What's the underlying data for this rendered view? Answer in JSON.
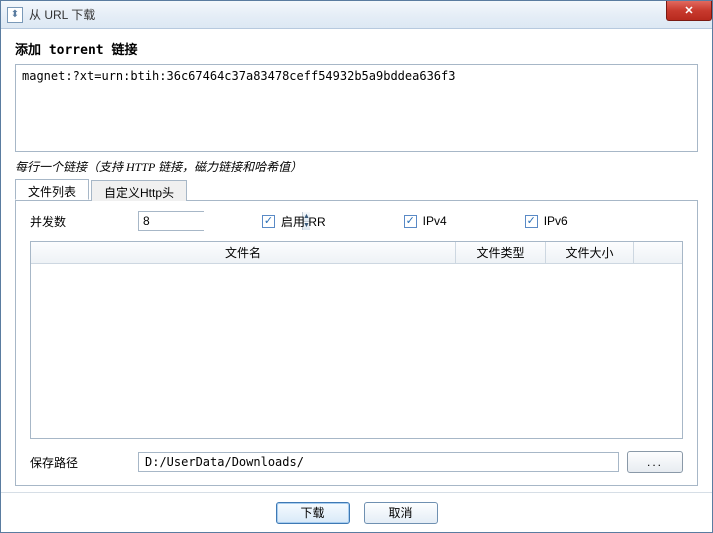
{
  "window": {
    "title": "从 URL 下载"
  },
  "section": {
    "heading": "添加 torrent 链接"
  },
  "url_input": {
    "value": "magnet:?xt=urn:btih:36c67464c37a83478ceff54932b5a9bddea636f3"
  },
  "hint": "每行一个链接（支持 HTTP 链接，磁力链接和哈希值）",
  "tabs": {
    "file_list": "文件列表",
    "http_headers": "自定义Http头"
  },
  "options": {
    "concurrency_label": "并发数",
    "concurrency_value": "8",
    "enable_rr_label": "启用 RR",
    "enable_rr_checked": true,
    "ipv4_label": "IPv4",
    "ipv4_checked": true,
    "ipv6_label": "IPv6",
    "ipv6_checked": true
  },
  "table": {
    "columns": {
      "name": "文件名",
      "type": "文件类型",
      "size": "文件大小"
    },
    "rows": []
  },
  "save": {
    "label": "保存路径",
    "value": "D:/UserData/Downloads/",
    "browse": "..."
  },
  "footer": {
    "download": "下载",
    "cancel": "取消"
  }
}
